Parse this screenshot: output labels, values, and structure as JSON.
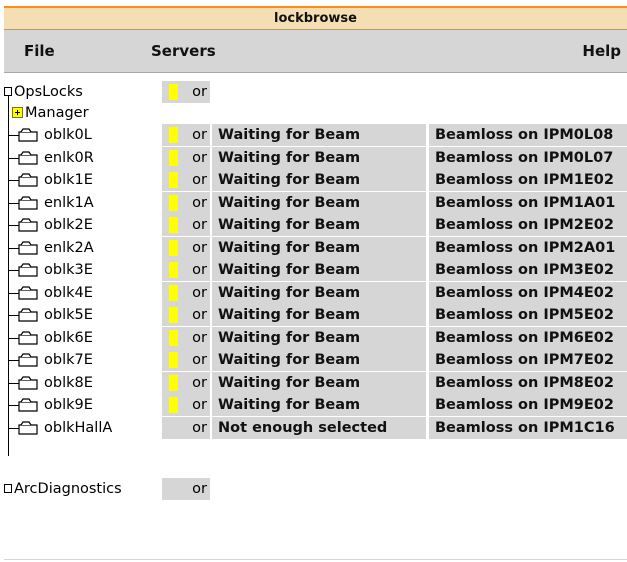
{
  "window": {
    "title": "lockbrowse"
  },
  "menu": {
    "file": "File",
    "servers": "Servers",
    "help": "Help"
  },
  "tree": {
    "root": {
      "label": "OpsLocks",
      "state": "or"
    },
    "manager": {
      "label": "Manager"
    },
    "locks": [
      {
        "name": "oblk0L",
        "state": "or",
        "status": "Waiting for Beam",
        "source": "Beamloss on IPM0L08",
        "indicator": true
      },
      {
        "name": "enlk0R",
        "state": "or",
        "status": "Waiting for Beam",
        "source": "Beamloss on IPM0L07",
        "indicator": true
      },
      {
        "name": "oblk1E",
        "state": "or",
        "status": "Waiting for Beam",
        "source": "Beamloss on IPM1E02",
        "indicator": true
      },
      {
        "name": "enlk1A",
        "state": "or",
        "status": "Waiting for Beam",
        "source": "Beamloss on IPM1A01",
        "indicator": true
      },
      {
        "name": "oblk2E",
        "state": "or",
        "status": "Waiting for Beam",
        "source": "Beamloss on IPM2E02",
        "indicator": true
      },
      {
        "name": "enlk2A",
        "state": "or",
        "status": "Waiting for Beam",
        "source": "Beamloss on IPM2A01",
        "indicator": true
      },
      {
        "name": "oblk3E",
        "state": "or",
        "status": "Waiting for Beam",
        "source": "Beamloss on IPM3E02",
        "indicator": true
      },
      {
        "name": "oblk4E",
        "state": "or",
        "status": "Waiting for Beam",
        "source": "Beamloss on IPM4E02",
        "indicator": true
      },
      {
        "name": "oblk5E",
        "state": "or",
        "status": "Waiting for Beam",
        "source": "Beamloss on IPM5E02",
        "indicator": true
      },
      {
        "name": "oblk6E",
        "state": "or",
        "status": "Waiting for Beam",
        "source": "Beamloss on IPM6E02",
        "indicator": true
      },
      {
        "name": "oblk7E",
        "state": "or",
        "status": "Waiting for Beam",
        "source": "Beamloss on IPM7E02",
        "indicator": true
      },
      {
        "name": "oblk8E",
        "state": "or",
        "status": "Waiting for Beam",
        "source": "Beamloss on IPM8E02",
        "indicator": true
      },
      {
        "name": "oblk9E",
        "state": "or",
        "status": "Waiting for Beam",
        "source": "Beamloss on IPM9E02",
        "indicator": true
      },
      {
        "name": "oblkHallA",
        "state": "or",
        "status": "Not enough selected",
        "source": "Beamloss on IPM1C16",
        "indicator": false
      }
    ],
    "arc": {
      "label": "ArcDiagnostics",
      "state": "or"
    }
  },
  "colors": {
    "indicator": "#ffff00",
    "cell_bg": "#d6d6d6",
    "title_bg": "#f5deb3",
    "title_border": "#ff8c1a"
  },
  "icons": [
    "folder-icon",
    "expand-icon"
  ]
}
